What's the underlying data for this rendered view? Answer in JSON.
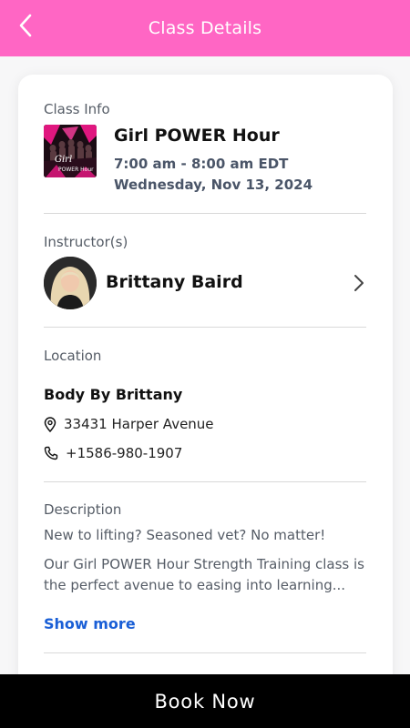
{
  "header": {
    "title": "Class Details",
    "back_icon": "chevron-left-icon",
    "color": "#ff66c4"
  },
  "class_info": {
    "label": "Class Info",
    "name": "Girl POWER Hour",
    "time": "7:00 am - 8:00 am EDT",
    "date": "Wednesday, Nov 13, 2024",
    "thumbnail_text_line1": "Girl",
    "thumbnail_text_line2": "POWER Hour"
  },
  "instructor": {
    "label": "Instructor(s)",
    "name": "Brittany Baird",
    "icon": "chevron-right-icon"
  },
  "location": {
    "label": "Location",
    "name": "Body By Brittany",
    "address": "33431 Harper Avenue",
    "phone": "+1586-980-1907",
    "address_icon": "map-pin-icon",
    "phone_icon": "phone-icon"
  },
  "description": {
    "label": "Description",
    "line1": "New to lifting? Seasoned vet? No matter!",
    "body": "Our Girl POWER Hour Strength Training class is the perfect avenue to easing into learning...",
    "show_more": "Show more",
    "link_color": "#1a5fd6"
  },
  "footer": {
    "book_label": "Book Now",
    "color": "#000000"
  }
}
